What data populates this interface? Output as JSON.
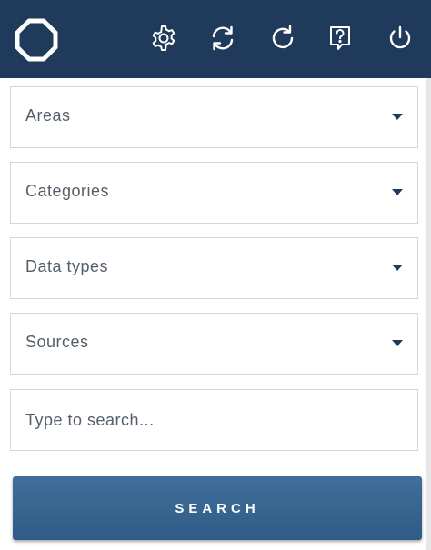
{
  "header": {
    "logo_icon": "octagon-logo-icon",
    "background_color": "#1f3a5a",
    "actions": [
      {
        "name": "settings",
        "icon": "gear-icon"
      },
      {
        "name": "sync",
        "icon": "sync-icon"
      },
      {
        "name": "refresh",
        "icon": "refresh-icon"
      },
      {
        "name": "help",
        "icon": "help-icon"
      },
      {
        "name": "power",
        "icon": "power-icon"
      }
    ]
  },
  "filters": {
    "areas": {
      "label": "Areas"
    },
    "categories": {
      "label": "Categories"
    },
    "data_types": {
      "label": "Data types"
    },
    "sources": {
      "label": "Sources"
    }
  },
  "search": {
    "placeholder": "Type to search...",
    "value": "",
    "button_label": "SEARCH",
    "button_color": "#3a6892"
  }
}
